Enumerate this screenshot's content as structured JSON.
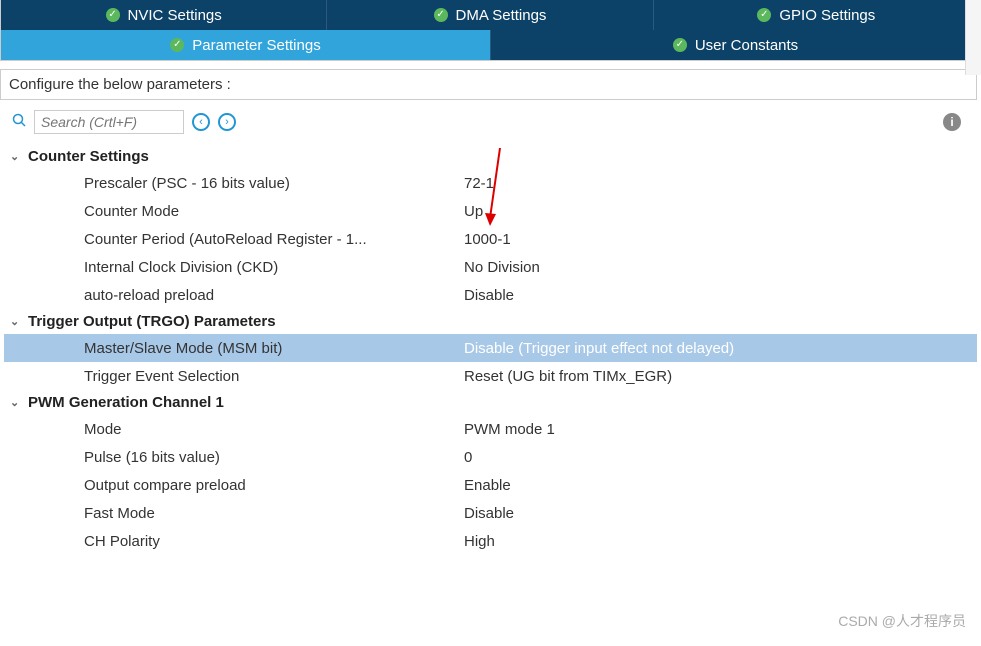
{
  "tabs": {
    "row1": [
      {
        "label": "NVIC Settings"
      },
      {
        "label": "DMA Settings"
      },
      {
        "label": "GPIO Settings"
      }
    ],
    "row2": [
      {
        "label": "Parameter Settings",
        "active": true
      },
      {
        "label": "User Constants",
        "active": false
      }
    ]
  },
  "configHeader": "Configure the below parameters :",
  "search": {
    "placeholder": "Search (Crtl+F)"
  },
  "groups": [
    {
      "title": "Counter Settings",
      "rows": [
        {
          "label": "Prescaler (PSC - 16 bits value)",
          "value": "72-1",
          "selected": false
        },
        {
          "label": "Counter Mode",
          "value": "Up",
          "selected": false
        },
        {
          "label": "Counter Period (AutoReload Register - 1...",
          "value": "1000-1",
          "selected": false
        },
        {
          "label": "Internal Clock Division (CKD)",
          "value": "No Division",
          "selected": false
        },
        {
          "label": "auto-reload preload",
          "value": "Disable",
          "selected": false
        }
      ]
    },
    {
      "title": "Trigger Output (TRGO) Parameters",
      "rows": [
        {
          "label": "Master/Slave Mode (MSM bit)",
          "value": "Disable (Trigger input effect not delayed)",
          "selected": true
        },
        {
          "label": "Trigger Event Selection",
          "value": "Reset (UG bit from TIMx_EGR)",
          "selected": false
        }
      ]
    },
    {
      "title": "PWM Generation Channel 1",
      "rows": [
        {
          "label": "Mode",
          "value": "PWM mode 1",
          "selected": false
        },
        {
          "label": "Pulse (16 bits value)",
          "value": "0",
          "selected": false
        },
        {
          "label": "Output compare preload",
          "value": "Enable",
          "selected": false
        },
        {
          "label": "Fast Mode",
          "value": "Disable",
          "selected": false
        },
        {
          "label": "CH Polarity",
          "value": "High",
          "selected": false
        }
      ]
    }
  ],
  "watermark": "CSDN @人才程序员"
}
